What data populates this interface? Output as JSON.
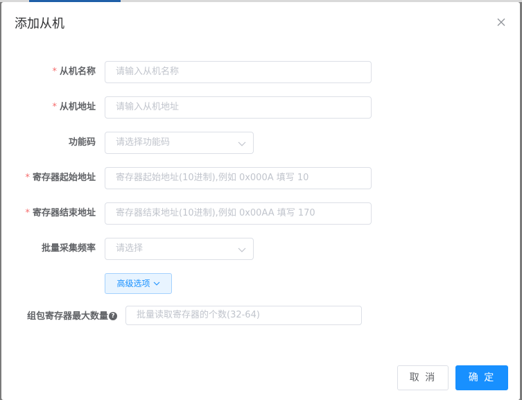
{
  "dialog": {
    "title": "添加从机",
    "close_icon": "close-icon"
  },
  "form": {
    "slave_name": {
      "label": "从机名称",
      "required": true,
      "placeholder": "请输入从机名称"
    },
    "slave_address": {
      "label": "从机地址",
      "required": true,
      "placeholder": "请输入从机地址"
    },
    "function_code": {
      "label": "功能码",
      "required": false,
      "placeholder": "请选择功能码"
    },
    "register_start": {
      "label": "寄存器起始地址",
      "required": true,
      "placeholder": "寄存器起始地址(10进制),例如 0x000A 填写 10"
    },
    "register_end": {
      "label": "寄存器结束地址",
      "required": true,
      "placeholder": "寄存器结束地址(10进制),例如 0x00AA 填写 170"
    },
    "batch_frequency": {
      "label": "批量采集频率",
      "required": false,
      "placeholder": "请选择"
    },
    "advanced_label": "高级选项",
    "max_group_registers": {
      "label": "组包寄存器最大数量",
      "placeholder": "批量读取寄存器的个数(32-64)",
      "help_icon": "question-circle-icon"
    }
  },
  "footer": {
    "cancel_label": "取 消",
    "confirm_label": "确 定"
  },
  "colors": {
    "primary": "#1890ff",
    "required_star": "#f56c6c",
    "advanced_bg": "#e8f4ff"
  }
}
